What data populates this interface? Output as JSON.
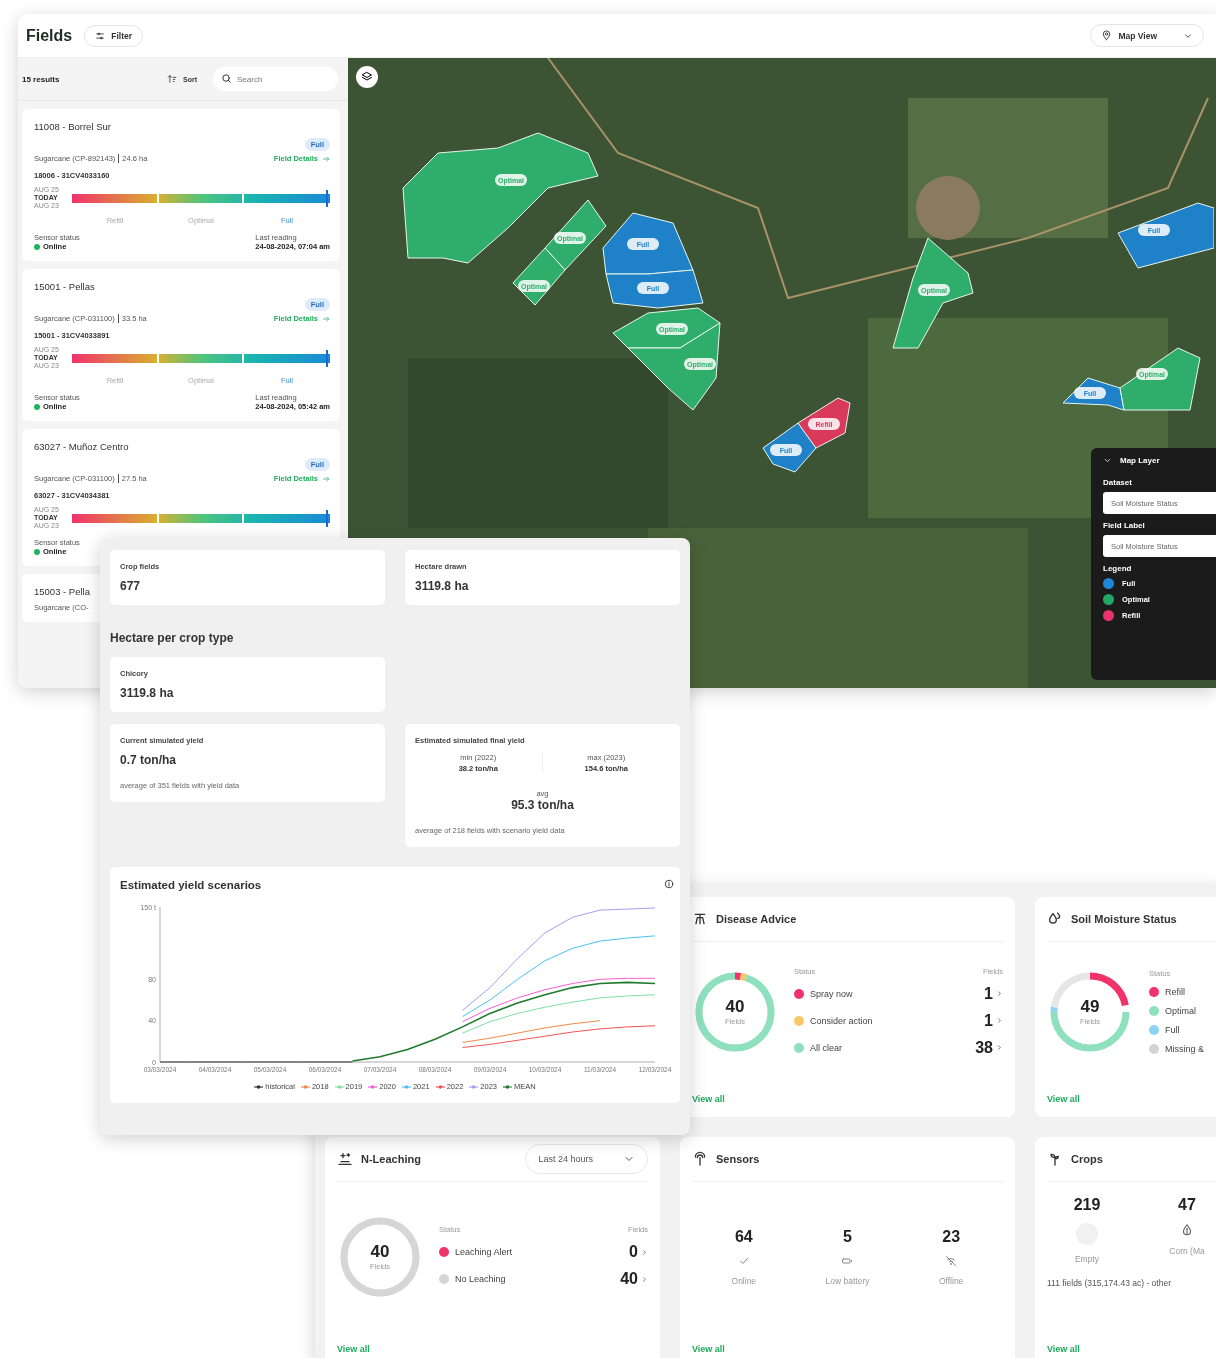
{
  "fields_window": {
    "title": "Fields",
    "filter_button": "Filter",
    "view_select": "Map View",
    "results": "15 results",
    "sort_button": "Sort",
    "search": {
      "placeholder": "Search"
    },
    "cards": [
      {
        "title": "11008 - Borrel Sur",
        "crop": "Sugarcane (CP-892143)",
        "area": "24.6 ha",
        "badge": "Full",
        "link": "Field Details",
        "sensor": "18006 - 31CV4033160",
        "scale_labels": [
          "AUG 25",
          "TODAY",
          "AUG 23"
        ],
        "level": 0.99,
        "status_levels": [
          {
            "label": "Refill",
            "selected": false
          },
          {
            "label": "Optimal",
            "selected": false
          },
          {
            "label": "Full",
            "selected": true
          }
        ],
        "sensor_status_label": "Sensor status",
        "sensor_status": "Online",
        "online": true,
        "reading_label": "Last reading",
        "reading": "24-08-2024, 07:04 am"
      },
      {
        "title": "15001 - Pellas",
        "crop": "Sugarcane (CP-031100)",
        "area": "33.5 ha",
        "badge": "Full",
        "link": "Field Details",
        "sensor": "15001 - 31CV4033891",
        "scale_labels": [
          "AUG 25",
          "TODAY",
          "AUG 23"
        ],
        "level": 0.99,
        "status_levels": [
          {
            "label": "Refill",
            "selected": false
          },
          {
            "label": "Optimal",
            "selected": false
          },
          {
            "label": "Full",
            "selected": true
          }
        ],
        "sensor_status_label": "Sensor status",
        "sensor_status": "Online",
        "online": true,
        "reading_label": "Last reading",
        "reading": "24-08-2024, 05:42 am"
      },
      {
        "title": "63027 - Muñoz Centro",
        "crop": "Sugarcane (CP-031100)",
        "area": "27.5 ha",
        "badge": "Full",
        "link": "Field Details",
        "sensor": "63027 - 31CV4034381",
        "scale_labels": [
          "AUG 25",
          "TODAY",
          "AUG 23"
        ],
        "level": 0.99,
        "sensor_status_label": "Sensor status",
        "sensor_status": "Online",
        "online": true
      },
      {
        "title": "15003 - Pella",
        "crop": "Sugarcane (CO-"
      }
    ]
  },
  "map": {
    "fields": [
      {
        "label": "Optimal",
        "kind": "optimal"
      },
      {
        "label": "Optimal",
        "kind": "optimal"
      },
      {
        "label": "Optimal",
        "kind": "optimal"
      },
      {
        "label": "Full",
        "kind": "full"
      },
      {
        "label": "Full",
        "kind": "full"
      },
      {
        "label": "Optimal",
        "kind": "optimal"
      },
      {
        "label": "Optimal",
        "kind": "optimal"
      },
      {
        "label": "Optimal",
        "kind": "optimal"
      },
      {
        "label": "Full",
        "kind": "full"
      },
      {
        "label": "Full",
        "kind": "full"
      },
      {
        "label": "Optimal",
        "kind": "optimal"
      },
      {
        "label": "Full",
        "kind": "full"
      },
      {
        "label": "Refill",
        "kind": "refill"
      }
    ],
    "layer_panel": {
      "title": "Map Layer",
      "dataset_label": "Dataset",
      "dataset": "Soil Moisture Status",
      "field_label_label": "Field Label",
      "field_label": "Soil Moisture Status",
      "legend_title": "Legend",
      "legend": [
        {
          "label": "Full",
          "color": "#1e88d6"
        },
        {
          "label": "Optimal",
          "color": "#22a866"
        },
        {
          "label": "Refill",
          "color": "#e8336b"
        }
      ]
    }
  },
  "stats": {
    "crop_fields": {
      "label": "Crop fields",
      "value": "677"
    },
    "hectare_drawn": {
      "label": "Hectare drawn",
      "value": "3119.8 ha"
    },
    "crop_type_heading": "Hectare per crop type",
    "crop_types": [
      {
        "label": "Chicory",
        "value": "3119.8 ha"
      }
    ],
    "current_yield": {
      "label": "Current simulated yield",
      "value": "0.7 ton/ha",
      "note": "average of 351 fields with yield data"
    },
    "final_yield": {
      "label": "Estimated simulated final yield",
      "min_label": "min (2022)",
      "min": "38.2 ton/ha",
      "max_label": "max (2023)",
      "max": "154.6 ton/ha",
      "avg_label": "avg",
      "avg": "95.3 ton/ha",
      "note": "average of 218 fields with scenario yield data"
    },
    "yield_chart": {
      "title": "Estimated yield scenarios",
      "chart_data": {
        "type": "line",
        "categories": [
          "03/03/2024",
          null,
          "04/03/2024",
          null,
          "05/03/2024",
          null,
          "06/03/2024",
          null,
          "07/03/2024",
          null,
          "08/03/2024",
          null,
          "09/03/2024",
          null,
          "10/03/2024",
          null,
          "11/03/2024",
          null,
          "12/03/2024"
        ],
        "ylim": [
          0,
          150
        ],
        "yticks": [
          0,
          40,
          80,
          {
            "value": 150,
            "label": "150 t"
          }
        ],
        "series": [
          {
            "name": "historical",
            "color": "#333333",
            "values": [
              0,
              0,
              0,
              0,
              0,
              0,
              0,
              0,
              null,
              null,
              null,
              null,
              null,
              null,
              null,
              null,
              null,
              null,
              null
            ]
          },
          {
            "name": "2018",
            "color": "#f08a4b",
            "values": [
              null,
              null,
              null,
              null,
              null,
              null,
              null,
              null,
              null,
              null,
              null,
              19,
              23,
              28,
              33,
              37,
              40,
              null,
              null
            ]
          },
          {
            "name": "2019",
            "color": "#7ee0a8",
            "values": [
              null,
              null,
              null,
              null,
              null,
              null,
              null,
              null,
              null,
              null,
              null,
              28,
              39,
              47,
              53,
              58,
              62,
              64,
              65
            ]
          },
          {
            "name": "2020",
            "color": "#f25fd0",
            "values": [
              null,
              null,
              null,
              null,
              null,
              null,
              null,
              null,
              null,
              null,
              null,
              39,
              52,
              62,
              70,
              76,
              80,
              81,
              81
            ]
          },
          {
            "name": "2021",
            "color": "#4cc3ee",
            "values": [
              null,
              null,
              null,
              null,
              null,
              null,
              null,
              null,
              null,
              null,
              null,
              44,
              60,
              80,
              98,
              110,
              117,
              120,
              122
            ]
          },
          {
            "name": "2022",
            "color": "#f2545b",
            "values": [
              null,
              null,
              null,
              null,
              null,
              null,
              null,
              null,
              null,
              null,
              null,
              14,
              17,
              21,
              25,
              29,
              32,
              34,
              35
            ]
          },
          {
            "name": "2023",
            "color": "#a99cf5",
            "values": [
              null,
              null,
              null,
              null,
              null,
              null,
              null,
              null,
              null,
              null,
              null,
              50,
              72,
              100,
              125,
              140,
              147,
              148,
              149
            ]
          },
          {
            "name": "MEAN",
            "color": "#1f7a2e",
            "values": [
              null,
              null,
              null,
              null,
              null,
              null,
              null,
              1,
              5,
              12,
              22,
              34,
              47,
              57,
              65,
              72,
              76,
              77,
              76
            ]
          }
        ]
      }
    }
  },
  "dashboard": {
    "disease": {
      "title": "Disease Advice",
      "total": "40",
      "total_label": "Fields",
      "status_header": "Status",
      "fields_header": "Fields",
      "rows": [
        {
          "label": "Spray now",
          "count": "1",
          "color": "#f0336b"
        },
        {
          "label": "Consider action",
          "count": "1",
          "color": "#f8c76a"
        },
        {
          "label": "All clear",
          "count": "38",
          "color": "#8ee0bf"
        }
      ],
      "link": "View all"
    },
    "soil": {
      "title": "Soil Moisture Status",
      "total": "49",
      "total_label": "Fields",
      "status_header": "Status",
      "rows": [
        {
          "label": "Refill",
          "color": "#f0336b"
        },
        {
          "label": "Optimal",
          "color": "#8ee0bf"
        },
        {
          "label": "Full",
          "color": "#8fd0f5"
        },
        {
          "label": "Missing &",
          "color": "#d4d4d4"
        }
      ],
      "link": "View all"
    },
    "leaching": {
      "title": "N-Leaching",
      "period": "Last 24 hours",
      "total": "40",
      "total_label": "Fields",
      "status_header": "Status",
      "fields_header": "Fields",
      "rows": [
        {
          "label": "Leaching Alert",
          "count": "0",
          "color": "#f0336b"
        },
        {
          "label": "No Leaching",
          "count": "40",
          "color": "#d6d6d6"
        }
      ],
      "link": "View all"
    },
    "sensors": {
      "title": "Sensors",
      "stats": [
        {
          "value": "64",
          "label": "Online",
          "kind": "online"
        },
        {
          "value": "5",
          "label": "Low battery",
          "kind": "battery"
        },
        {
          "value": "23",
          "label": "Offline",
          "kind": "offline"
        }
      ],
      "link": "View all"
    },
    "crops": {
      "title": "Crops",
      "stats": [
        {
          "value": "219",
          "label": "Empty",
          "kind": "empty"
        },
        {
          "value": "47",
          "label": "Corn (Ma",
          "kind": "corn"
        }
      ],
      "note": "111 fields (315,174.43 ac) - other",
      "link": "View all"
    }
  }
}
